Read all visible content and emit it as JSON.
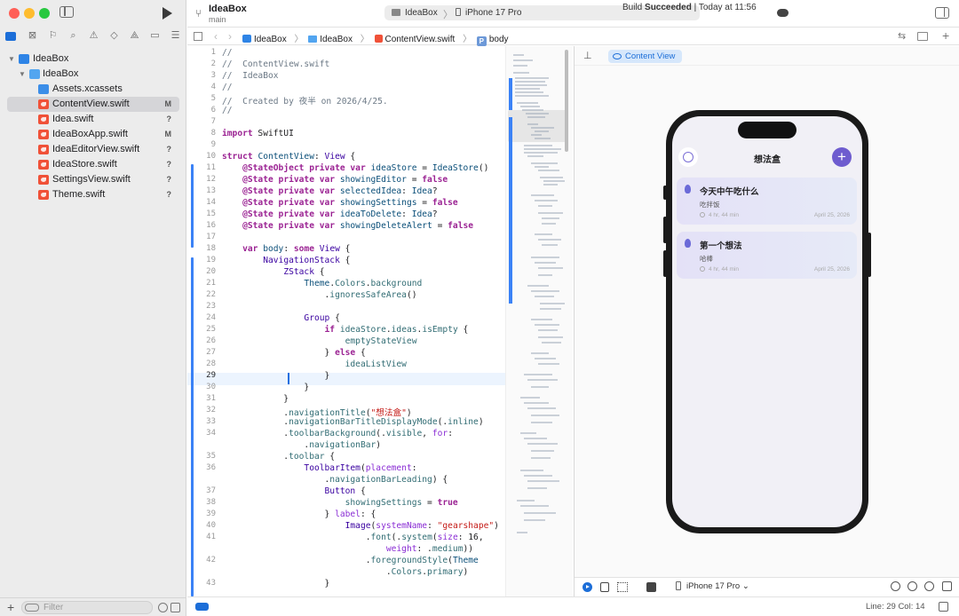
{
  "toolbar": {
    "project": "IdeaBox",
    "branch": "main",
    "scheme": "IdeaBox",
    "destination": "iPhone 17 Pro",
    "build_status": "Build",
    "build_result": "Succeeded",
    "build_time": "| Today at 11:56"
  },
  "sidebar": {
    "filter_placeholder": "Filter",
    "items": [
      {
        "label": "IdeaBox",
        "status": ""
      },
      {
        "label": "IdeaBox",
        "status": ""
      },
      {
        "label": "Assets.xcassets",
        "status": ""
      },
      {
        "label": "ContentView.swift",
        "status": "M"
      },
      {
        "label": "Idea.swift",
        "status": "?"
      },
      {
        "label": "IdeaBoxApp.swift",
        "status": "M"
      },
      {
        "label": "IdeaEditorView.swift",
        "status": "?"
      },
      {
        "label": "IdeaStore.swift",
        "status": "?"
      },
      {
        "label": "SettingsView.swift",
        "status": "?"
      },
      {
        "label": "Theme.swift",
        "status": "?"
      }
    ]
  },
  "breadcrumbs": [
    "IdeaBox",
    "IdeaBox",
    "ContentView.swift",
    "body"
  ],
  "editor": {
    "current_line": 29,
    "line_numbers": [
      "1",
      "2",
      "3",
      "4",
      "5",
      "6",
      "7",
      "8",
      "9",
      "10",
      "11",
      "12",
      "13",
      "14",
      "15",
      "16",
      "17",
      "18",
      "19",
      "20",
      "21",
      "22",
      "23",
      "24",
      "25",
      "26",
      "27",
      "28",
      "29",
      "30",
      "31",
      "32",
      "33",
      "34",
      "35",
      "36",
      "37",
      "38",
      "39",
      "40",
      "41",
      "42",
      "43"
    ]
  },
  "canvas": {
    "label": "Content View",
    "device": "iPhone 17 Pro"
  },
  "app_preview": {
    "nav_title": "想法盒",
    "add_label": "+",
    "ideas": [
      {
        "title": "今天中午吃什么",
        "subtitle": "吃拌饭",
        "age": "4 hr, 44 min",
        "date": "April 25, 2026"
      },
      {
        "title": "第一个想法",
        "subtitle": "哈棒",
        "age": "4 hr, 44 min",
        "date": "April 25, 2026"
      }
    ]
  },
  "status": {
    "position": "Line: 29  Col: 14"
  },
  "colors": {
    "accent": "#1c6ed8",
    "app_primary": "#6e5ccf"
  }
}
